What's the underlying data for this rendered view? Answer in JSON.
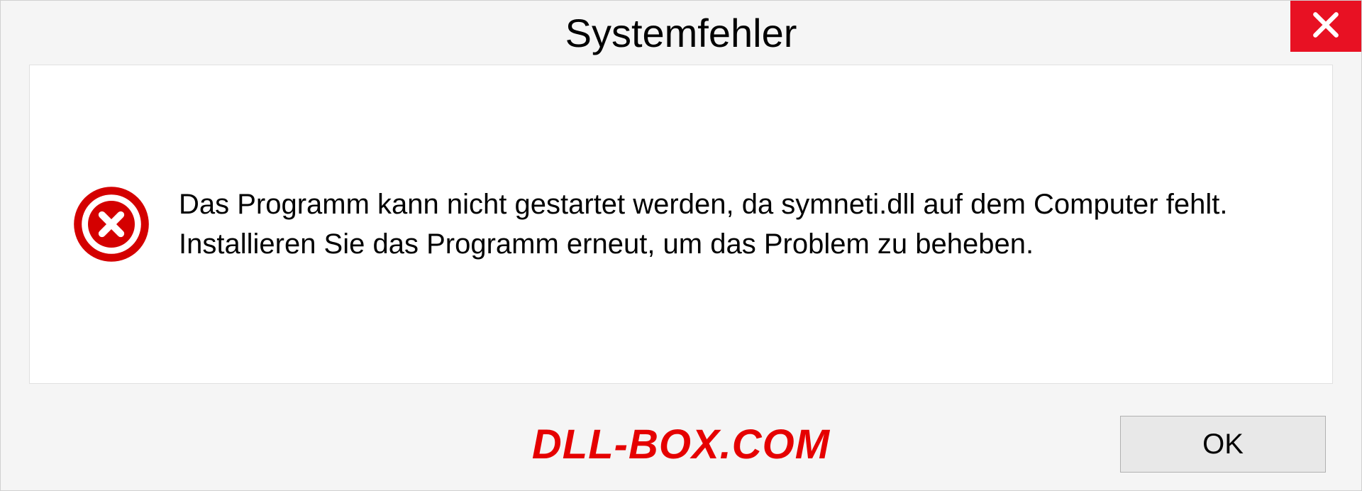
{
  "dialog": {
    "title": "Systemfehler",
    "message": "Das Programm kann nicht gestartet werden, da symneti.dll auf dem Computer fehlt. Installieren Sie das Programm erneut, um das Problem zu beheben.",
    "ok_label": "OK"
  },
  "watermark": {
    "text": "DLL-BOX.COM"
  },
  "colors": {
    "close_bg": "#e81123",
    "error_icon": "#d40000",
    "watermark": "#e50000"
  }
}
